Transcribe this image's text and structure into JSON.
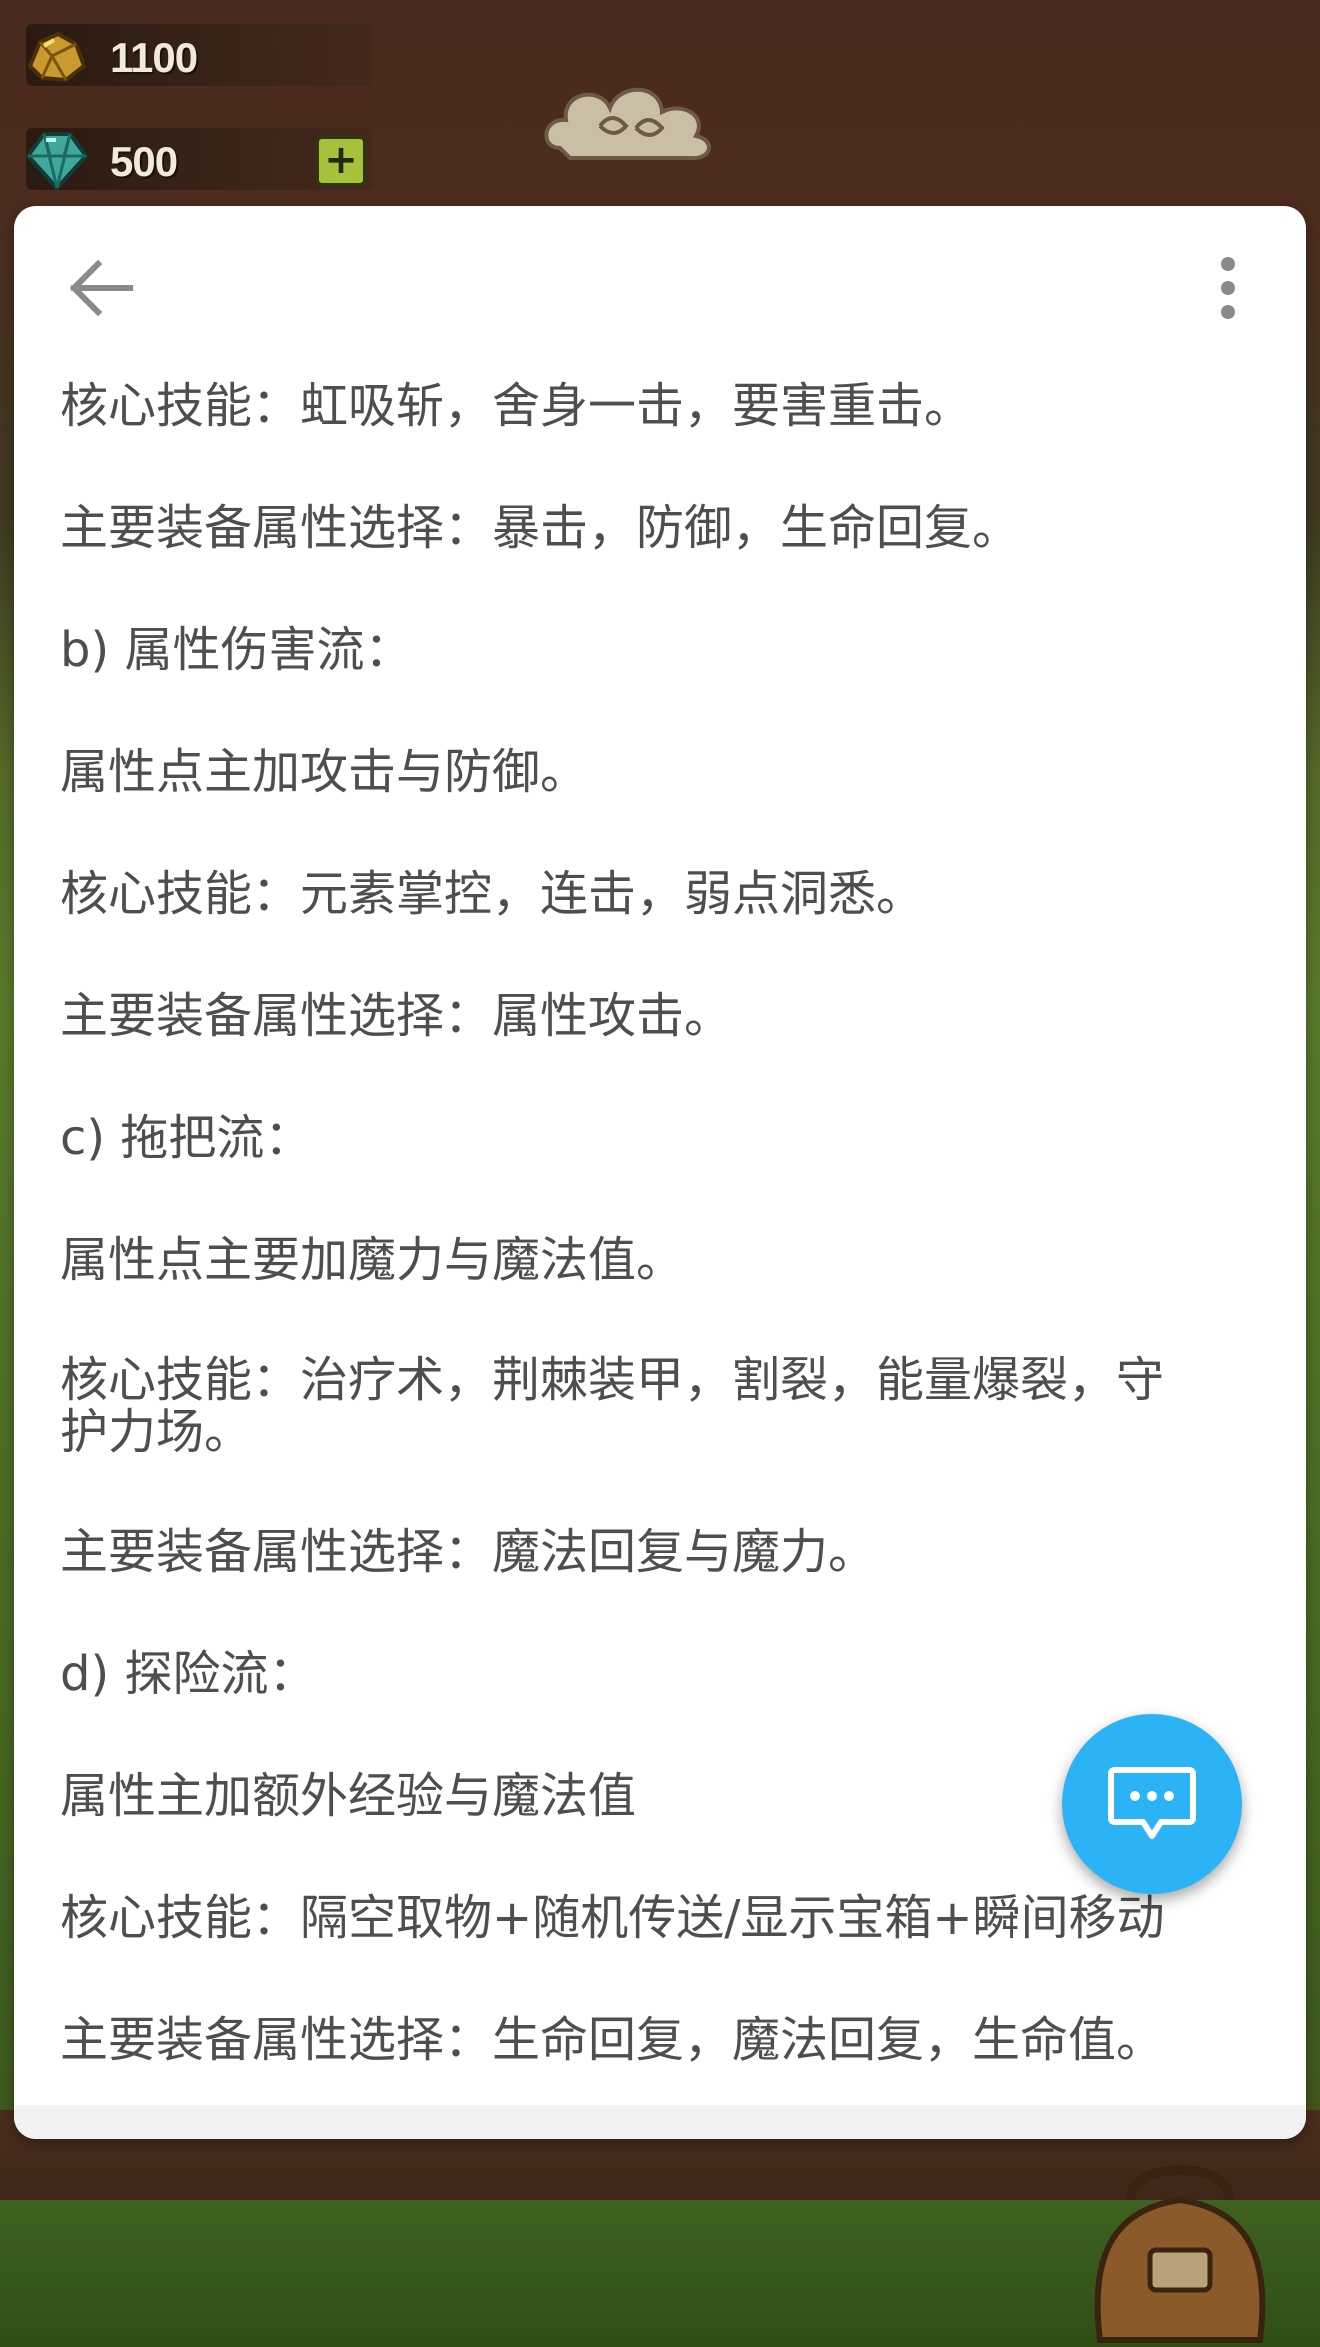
{
  "hud": {
    "gold_value": "1100",
    "gem_value": "500",
    "gem_plus_label": "+"
  },
  "article": {
    "paragraphs": [
      "核心技能：虹吸斩，舍身一击，要害重击。",
      "主要装备属性选择：暴击，防御，生命回复。",
      "b) 属性伤害流：",
      "属性点主加攻击与防御。",
      "核心技能：元素掌控，连击，弱点洞悉。",
      "主要装备属性选择：属性攻击。",
      "c) 拖把流：",
      "属性点主要加魔力与魔法值。",
      "核心技能：治疗术，荆棘装甲，割裂，能量爆裂，守\n护力场。",
      "主要装备属性选择：魔法回复与魔力。",
      "d) 探险流：",
      "属性主加额外经验与魔法值",
      "核心技能：隔空取物+随机传送/显示宝箱+瞬间移动",
      "主要装备属性选择：生命回复，魔法回复，生命值。"
    ]
  },
  "icons": {
    "back": "arrow-left-icon",
    "more": "more-vert-icon",
    "fab": "chat-bubble-icon",
    "gold": "gold-ore-icon",
    "gem": "gem-icon"
  },
  "colors": {
    "fab": "#2bb3f5",
    "text": "#4e4e4e",
    "card": "#ffffff",
    "icon_gray": "#8a8a8a"
  }
}
